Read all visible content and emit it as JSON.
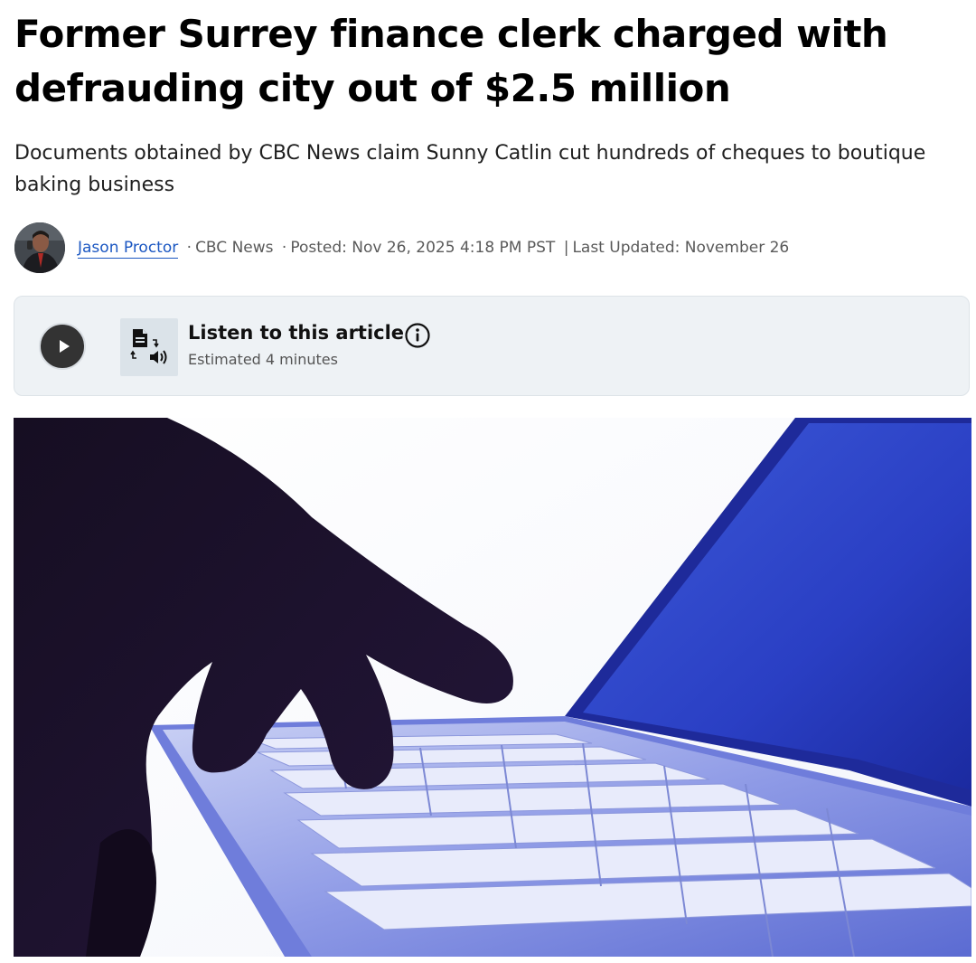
{
  "article": {
    "headline": "Former Surrey finance clerk charged with defrauding city out of $2.5 million",
    "deck": "Documents obtained by CBC News claim Sunny Catlin cut hundreds of cheques to boutique baking business"
  },
  "byline": {
    "author": "Jason Proctor",
    "outlet": "CBC News",
    "posted": "Posted: Nov 26, 2025 4:18 PM PST",
    "updated": "Last Updated: November 26",
    "sep_dot": "·",
    "sep_bar": "|"
  },
  "listen": {
    "title": "Listen to this article",
    "subtitle": "Estimated 4 minutes"
  },
  "icons": {
    "play": "play-icon",
    "tts": "text-to-speech-icon",
    "info": "info-icon"
  },
  "colors": {
    "link": "#1b57c2",
    "listen_bg": "#eef2f5"
  }
}
